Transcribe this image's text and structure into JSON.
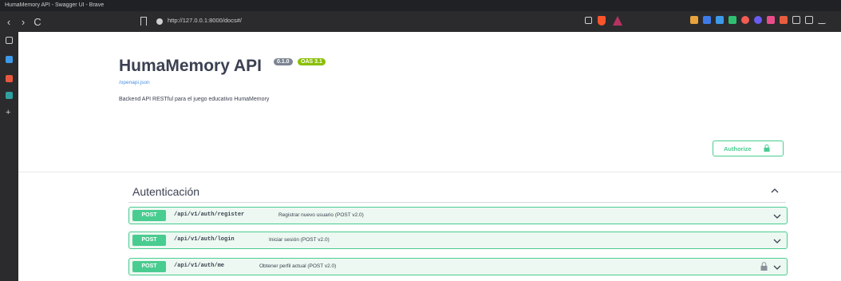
{
  "window": {
    "title": "HumaMemory API - Swagger UI - Brave"
  },
  "browser": {
    "url": "http://127.0.0.1:8000/docs#/",
    "nav": {
      "back": "‹",
      "forward": "›",
      "reload": "C"
    }
  },
  "api": {
    "title": "HumaMemory API",
    "version": "0.1.0",
    "oas": "OAS 3.1",
    "spec_link": "/openapi.json",
    "description": "Backend API RESTful para el juego educativo HumaMemory",
    "authorize_label": "Authorize"
  },
  "tag": {
    "title": "Autenticación"
  },
  "operations": [
    {
      "method": "POST",
      "path": "/api/v1/auth/register",
      "summary": "Registrar nuevo usuario (POST v2.0)",
      "locked": false
    },
    {
      "method": "POST",
      "path": "/api/v1/auth/login",
      "summary": "Iniciar sesión (POST v2.0)",
      "locked": false
    },
    {
      "method": "POST",
      "path": "/api/v1/auth/me",
      "summary": "Obtener perfil actual (POST v2.0)",
      "locked": true
    }
  ],
  "colors": {
    "post": "#49cc90",
    "post_bg": "#ecf8f1",
    "link": "#4990e2",
    "text": "#3b4151"
  }
}
